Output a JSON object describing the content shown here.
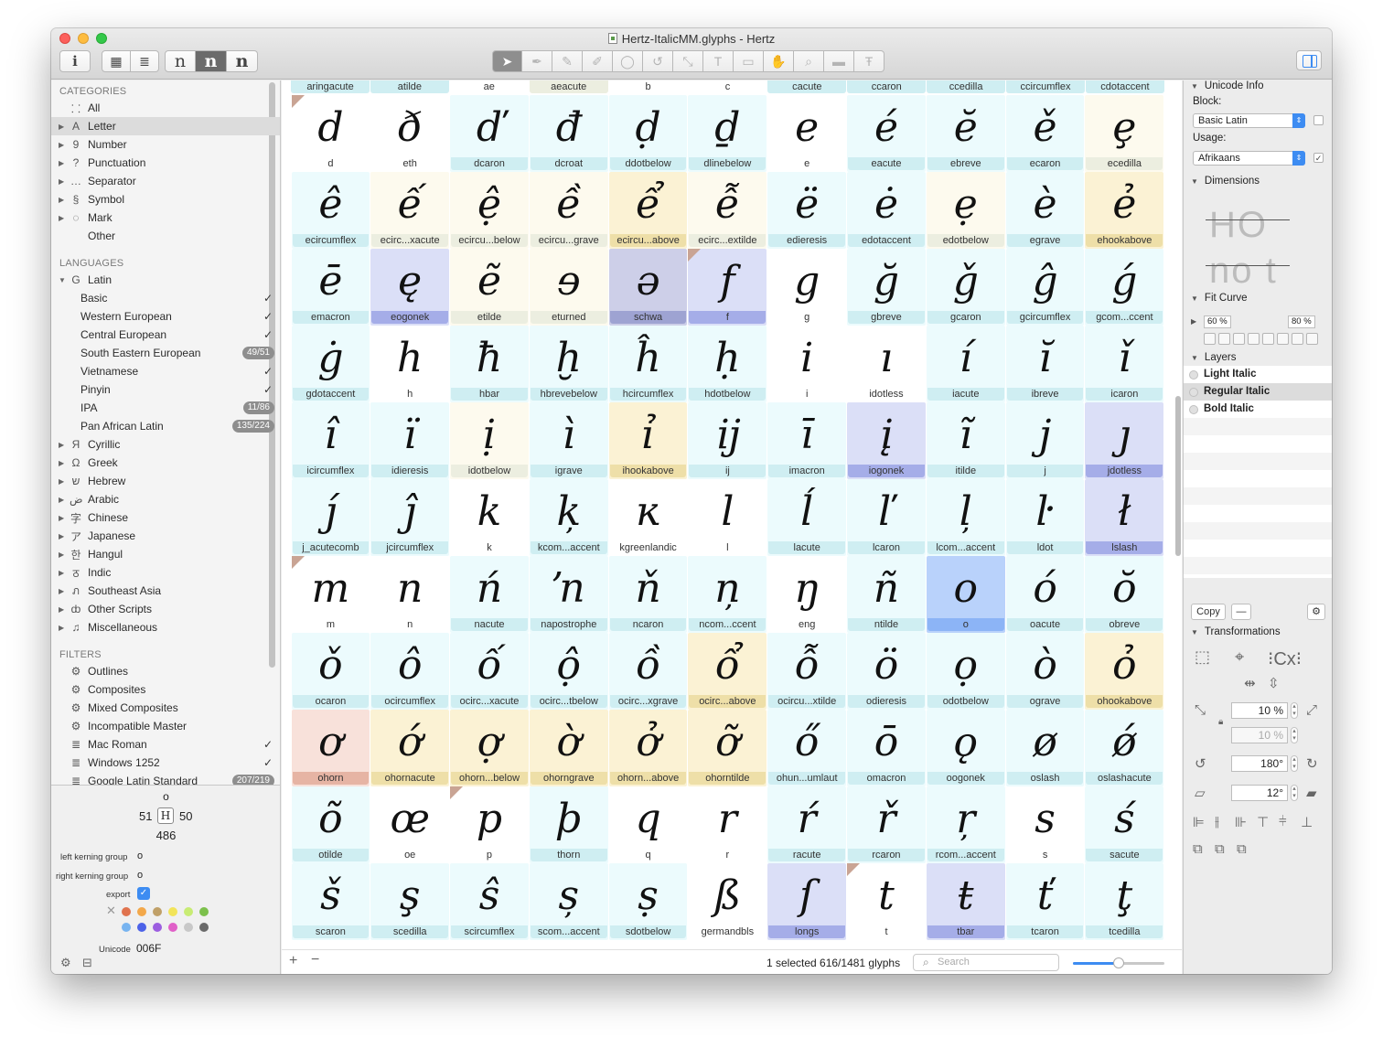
{
  "window": {
    "title": "Hertz-ItalicMM.glyphs - Hertz"
  },
  "toolbar": {
    "info_icon": "i",
    "grid_view_icon": "grid-icon",
    "list_view_icon": "list-icon",
    "preview_glyphs": [
      "n",
      "n",
      "n"
    ],
    "tools": [
      "select-tool",
      "draw-tool",
      "pencil-tool",
      "brush-tool",
      "primitives-tool",
      "rotate-tool",
      "scale-tool",
      "text-tool",
      "annotation-tool",
      "hand-tool",
      "zoom-tool",
      "measurement-tool",
      "type-tool"
    ]
  },
  "sidebar": {
    "categories_header": "CATEGORIES",
    "categories": [
      {
        "icon": "⸬",
        "label": "All"
      },
      {
        "icon": "A",
        "label": "Letter",
        "selected": true,
        "expandable": true
      },
      {
        "icon": "9",
        "label": "Number",
        "expandable": true
      },
      {
        "icon": "?",
        "label": "Punctuation",
        "expandable": true
      },
      {
        "icon": "…",
        "label": "Separator",
        "expandable": true
      },
      {
        "icon": "§",
        "label": "Symbol",
        "expandable": true
      },
      {
        "icon": "◌",
        "label": "Mark",
        "expandable": true
      },
      {
        "icon": "",
        "label": "Other"
      }
    ],
    "languages_header": "LANGUAGES",
    "latin": {
      "icon": "G",
      "label": "Latin"
    },
    "latin_items": [
      {
        "label": "Basic",
        "check": "✓"
      },
      {
        "label": "Western European",
        "check": "✓"
      },
      {
        "label": "Central European",
        "check": "✓"
      },
      {
        "label": "South Eastern European",
        "badge": "49/51"
      },
      {
        "label": "Vietnamese",
        "check": "✓"
      },
      {
        "label": "Pinyin",
        "check": "✓"
      },
      {
        "label": "IPA",
        "badge": "11/86"
      },
      {
        "label": "Pan African Latin",
        "badge": "135/224"
      }
    ],
    "scripts": [
      {
        "icon": "Я",
        "label": "Cyrillic"
      },
      {
        "icon": "Ω",
        "label": "Greek"
      },
      {
        "icon": "ש",
        "label": "Hebrew"
      },
      {
        "icon": "ض",
        "label": "Arabic"
      },
      {
        "icon": "字",
        "label": "Chinese"
      },
      {
        "icon": "ア",
        "label": "Japanese"
      },
      {
        "icon": "한",
        "label": "Hangul"
      },
      {
        "icon": "ठ",
        "label": "Indic"
      },
      {
        "icon": "ภ",
        "label": "Southeast Asia"
      },
      {
        "icon": "ȸ",
        "label": "Other Scripts"
      },
      {
        "icon": "♫",
        "label": "Miscellaneous"
      }
    ],
    "filters_header": "FILTERS",
    "filters": [
      {
        "icon": "⚙",
        "label": "Outlines"
      },
      {
        "icon": "⚙",
        "label": "Composites"
      },
      {
        "icon": "⚙",
        "label": "Mixed Composites"
      },
      {
        "icon": "⚙",
        "label": "Incompatible Master"
      },
      {
        "icon": "≣",
        "label": "Mac Roman",
        "check": "✓"
      },
      {
        "icon": "≣",
        "label": "Windows 1252",
        "check": "✓"
      },
      {
        "icon": "≣",
        "label": "Google Latin Standard",
        "badge": "207/219"
      }
    ]
  },
  "glyph_info": {
    "name": "o",
    "lsb": "51",
    "rsb": "50",
    "width": "486",
    "glyph_char": "H",
    "left_kerning_label": "left kerning group",
    "left_kerning_value": "o",
    "right_kerning_label": "right kerning group",
    "right_kerning_value": "o",
    "export_label": "export",
    "export_checked": "✓",
    "unicode_label": "Unicode",
    "unicode_value": "006F",
    "color_clear": "✕",
    "colors_row1": [
      "#e0734e",
      "#f3a84a",
      "#c0a068",
      "#f2e45a",
      "#c8ec74",
      "#7cc04c"
    ],
    "colors_row2": [
      "#78b4f0",
      "#4c62e8",
      "#9c5ee0",
      "#e060c8",
      "#c8c8c8",
      "#6a6a6a"
    ]
  },
  "grid": {
    "top_row": [
      {
        "name": "aringacute",
        "kind": "cyan"
      },
      {
        "name": "atilde",
        "kind": "cyan"
      },
      {
        "name": "ae",
        "kind": "white"
      },
      {
        "name": "aeacute",
        "kind": "cream"
      },
      {
        "name": "b",
        "kind": "white"
      },
      {
        "name": "c",
        "kind": "white"
      },
      {
        "name": "cacute",
        "kind": "cyan"
      },
      {
        "name": "ccaron",
        "kind": "cyan"
      },
      {
        "name": "ccedilla",
        "kind": "cyan"
      },
      {
        "name": "ccircumflex",
        "kind": "cyan"
      },
      {
        "name": "cdotaccent",
        "kind": "cyan"
      }
    ],
    "cells": [
      {
        "g": "d",
        "name": "d",
        "kind": "white",
        "corner": true
      },
      {
        "g": "ð",
        "name": "eth",
        "kind": "white"
      },
      {
        "g": "ď",
        "name": "dcaron",
        "kind": "cyan"
      },
      {
        "g": "đ",
        "name": "dcroat",
        "kind": "cyan"
      },
      {
        "g": "ḍ",
        "name": "ddotbelow",
        "kind": "cyan"
      },
      {
        "g": "ḏ",
        "name": "dlinebelow",
        "kind": "cyan"
      },
      {
        "g": "e",
        "name": "e",
        "kind": "white"
      },
      {
        "g": "é",
        "name": "eacute",
        "kind": "cyan"
      },
      {
        "g": "ĕ",
        "name": "ebreve",
        "kind": "cyan"
      },
      {
        "g": "ě",
        "name": "ecaron",
        "kind": "cyan"
      },
      {
        "g": "ȩ",
        "name": "ecedilla",
        "kind": "cream"
      },
      {
        "g": "ê",
        "name": "ecircumflex",
        "kind": "cyan"
      },
      {
        "g": "ế",
        "name": "ecirc...xacute",
        "kind": "cream"
      },
      {
        "g": "ệ",
        "name": "ecircu...below",
        "kind": "cream"
      },
      {
        "g": "ề",
        "name": "ecircu...grave",
        "kind": "cream"
      },
      {
        "g": "ể",
        "name": "ecircu...above",
        "kind": "yellow"
      },
      {
        "g": "ễ",
        "name": "ecirc...extilde",
        "kind": "cream"
      },
      {
        "g": "ë",
        "name": "edieresis",
        "kind": "cyan"
      },
      {
        "g": "ė",
        "name": "edotaccent",
        "kind": "cyan"
      },
      {
        "g": "ẹ",
        "name": "edotbelow",
        "kind": "cream"
      },
      {
        "g": "è",
        "name": "egrave",
        "kind": "cyan"
      },
      {
        "g": "ẻ",
        "name": "ehookabove",
        "kind": "yellow"
      },
      {
        "g": "ē",
        "name": "emacron",
        "kind": "cyan"
      },
      {
        "g": "ę",
        "name": "eogonek",
        "kind": "purple"
      },
      {
        "g": "ẽ",
        "name": "etilde",
        "kind": "cream"
      },
      {
        "g": "ɘ",
        "name": "eturned",
        "kind": "cream"
      },
      {
        "g": "ə",
        "name": "schwa",
        "kind": "schwa"
      },
      {
        "g": "f",
        "name": "f",
        "kind": "purple",
        "corner": true
      },
      {
        "g": "g",
        "name": "g",
        "kind": "white"
      },
      {
        "g": "ğ",
        "name": "gbreve",
        "kind": "cyan"
      },
      {
        "g": "ǧ",
        "name": "gcaron",
        "kind": "cyan"
      },
      {
        "g": "ĝ",
        "name": "gcircumflex",
        "kind": "cyan"
      },
      {
        "g": "ǵ",
        "name": "gcom...ccent",
        "kind": "cyan"
      },
      {
        "g": "ġ",
        "name": "gdotaccent",
        "kind": "cyan"
      },
      {
        "g": "h",
        "name": "h",
        "kind": "white"
      },
      {
        "g": "ħ",
        "name": "hbar",
        "kind": "cyan"
      },
      {
        "g": "ḫ",
        "name": "hbrevebelow",
        "kind": "cyan"
      },
      {
        "g": "ĥ",
        "name": "hcircumflex",
        "kind": "cyan"
      },
      {
        "g": "ḥ",
        "name": "hdotbelow",
        "kind": "cyan"
      },
      {
        "g": "i",
        "name": "i",
        "kind": "white"
      },
      {
        "g": "ı",
        "name": "idotless",
        "kind": "white"
      },
      {
        "g": "í",
        "name": "iacute",
        "kind": "cyan"
      },
      {
        "g": "ĭ",
        "name": "ibreve",
        "kind": "cyan"
      },
      {
        "g": "ǐ",
        "name": "icaron",
        "kind": "cyan"
      },
      {
        "g": "î",
        "name": "icircumflex",
        "kind": "cyan"
      },
      {
        "g": "ï",
        "name": "idieresis",
        "kind": "cyan"
      },
      {
        "g": "ị",
        "name": "idotbelow",
        "kind": "cream"
      },
      {
        "g": "ì",
        "name": "igrave",
        "kind": "cyan"
      },
      {
        "g": "ỉ",
        "name": "ihookabove",
        "kind": "yellow"
      },
      {
        "g": "ĳ",
        "name": "ij",
        "kind": "cyan"
      },
      {
        "g": "ī",
        "name": "imacron",
        "kind": "cyan"
      },
      {
        "g": "į",
        "name": "iogonek",
        "kind": "purple"
      },
      {
        "g": "ĩ",
        "name": "itilde",
        "kind": "cyan"
      },
      {
        "g": "j",
        "name": "j",
        "kind": "cyan"
      },
      {
        "g": "ȷ",
        "name": "jdotless",
        "kind": "purple"
      },
      {
        "g": "ȷ́",
        "name": "j_acutecomb",
        "kind": "cyan"
      },
      {
        "g": "ĵ",
        "name": "jcircumflex",
        "kind": "cyan"
      },
      {
        "g": "k",
        "name": "k",
        "kind": "white"
      },
      {
        "g": "ķ",
        "name": "kcom...accent",
        "kind": "cyan"
      },
      {
        "g": "ĸ",
        "name": "kgreenlandic",
        "kind": "white"
      },
      {
        "g": "l",
        "name": "l",
        "kind": "white"
      },
      {
        "g": "ĺ",
        "name": "lacute",
        "kind": "cyan"
      },
      {
        "g": "ľ",
        "name": "lcaron",
        "kind": "cyan"
      },
      {
        "g": "ļ",
        "name": "lcom...accent",
        "kind": "cyan"
      },
      {
        "g": "ŀ",
        "name": "ldot",
        "kind": "cyan"
      },
      {
        "g": "ł",
        "name": "lslash",
        "kind": "purple"
      },
      {
        "g": "m",
        "name": "m",
        "kind": "white",
        "corner": true
      },
      {
        "g": "n",
        "name": "n",
        "kind": "white"
      },
      {
        "g": "ń",
        "name": "nacute",
        "kind": "cyan"
      },
      {
        "g": "ŉ",
        "name": "napostrophe",
        "kind": "cyan"
      },
      {
        "g": "ň",
        "name": "ncaron",
        "kind": "cyan"
      },
      {
        "g": "ņ",
        "name": "ncom...ccent",
        "kind": "cyan"
      },
      {
        "g": "ŋ",
        "name": "eng",
        "kind": "white"
      },
      {
        "g": "ñ",
        "name": "ntilde",
        "kind": "cyan"
      },
      {
        "g": "o",
        "name": "o",
        "kind": "sel"
      },
      {
        "g": "ó",
        "name": "oacute",
        "kind": "cyan"
      },
      {
        "g": "ŏ",
        "name": "obreve",
        "kind": "cyan"
      },
      {
        "g": "ǒ",
        "name": "ocaron",
        "kind": "cyan"
      },
      {
        "g": "ô",
        "name": "ocircumflex",
        "kind": "cyan"
      },
      {
        "g": "ố",
        "name": "ocirc...xacute",
        "kind": "cyan"
      },
      {
        "g": "ộ",
        "name": "ocirc...tbelow",
        "kind": "cyan"
      },
      {
        "g": "ồ",
        "name": "ocirc...xgrave",
        "kind": "cyan"
      },
      {
        "g": "ổ",
        "name": "ocirc...above",
        "kind": "yellow"
      },
      {
        "g": "ỗ",
        "name": "ocircu...xtilde",
        "kind": "cyan"
      },
      {
        "g": "ö",
        "name": "odieresis",
        "kind": "cyan"
      },
      {
        "g": "ọ",
        "name": "odotbelow",
        "kind": "cyan"
      },
      {
        "g": "ò",
        "name": "ograve",
        "kind": "cyan"
      },
      {
        "g": "ỏ",
        "name": "ohookabove",
        "kind": "yellow"
      },
      {
        "g": "ơ",
        "name": "ohorn",
        "kind": "pink"
      },
      {
        "g": "ớ",
        "name": "ohornacute",
        "kind": "yellow"
      },
      {
        "g": "ợ",
        "name": "ohorn...below",
        "kind": "yellow"
      },
      {
        "g": "ờ",
        "name": "ohorngrave",
        "kind": "yellow"
      },
      {
        "g": "ở",
        "name": "ohorn...above",
        "kind": "yellow"
      },
      {
        "g": "ỡ",
        "name": "ohorntilde",
        "kind": "yellow"
      },
      {
        "g": "ő",
        "name": "ohun...umlaut",
        "kind": "cyan"
      },
      {
        "g": "ō",
        "name": "omacron",
        "kind": "cyan"
      },
      {
        "g": "ǫ",
        "name": "oogonek",
        "kind": "cyan"
      },
      {
        "g": "ø",
        "name": "oslash",
        "kind": "cyan"
      },
      {
        "g": "ǿ",
        "name": "oslashacute",
        "kind": "cyan"
      },
      {
        "g": "õ",
        "name": "otilde",
        "kind": "cyan"
      },
      {
        "g": "œ",
        "name": "oe",
        "kind": "white"
      },
      {
        "g": "p",
        "name": "p",
        "kind": "white",
        "corner": true
      },
      {
        "g": "þ",
        "name": "thorn",
        "kind": "cyan"
      },
      {
        "g": "q",
        "name": "q",
        "kind": "white"
      },
      {
        "g": "r",
        "name": "r",
        "kind": "white"
      },
      {
        "g": "ŕ",
        "name": "racute",
        "kind": "cyan"
      },
      {
        "g": "ř",
        "name": "rcaron",
        "kind": "cyan"
      },
      {
        "g": "ŗ",
        "name": "rcom...accent",
        "kind": "cyan"
      },
      {
        "g": "s",
        "name": "s",
        "kind": "white"
      },
      {
        "g": "ś",
        "name": "sacute",
        "kind": "cyan"
      },
      {
        "g": "š",
        "name": "scaron",
        "kind": "cyan"
      },
      {
        "g": "ş",
        "name": "scedilla",
        "kind": "cyan"
      },
      {
        "g": "ŝ",
        "name": "scircumflex",
        "kind": "cyan"
      },
      {
        "g": "ș",
        "name": "scom...accent",
        "kind": "cyan"
      },
      {
        "g": "ṣ",
        "name": "sdotbelow",
        "kind": "cyan"
      },
      {
        "g": "ß",
        "name": "germandbls",
        "kind": "white"
      },
      {
        "g": "ſ",
        "name": "longs",
        "kind": "purple"
      },
      {
        "g": "t",
        "name": "t",
        "kind": "white",
        "corner": true
      },
      {
        "g": "ŧ",
        "name": "tbar",
        "kind": "purple"
      },
      {
        "g": "ť",
        "name": "tcaron",
        "kind": "cyan"
      },
      {
        "g": "ţ",
        "name": "tcedilla",
        "kind": "cyan"
      }
    ]
  },
  "statusbar": {
    "add": "+",
    "remove": "−",
    "status": "1 selected 616/1481 glyphs",
    "search_placeholder": "Search",
    "zoom_level": 0.5
  },
  "inspector": {
    "unicode_info": "Unicode Info",
    "block_label": "Block:",
    "block_value": "Basic Latin",
    "usage_label": "Usage:",
    "usage_value": "Afrikaans",
    "usage_checked": "✓",
    "dimensions": "Dimensions",
    "dim_preview_top": "HO",
    "dim_preview_bottom": "no t",
    "fit_curve": "Fit Curve",
    "fit_min": "60 %",
    "fit_max": "80 %",
    "layers": "Layers",
    "layer_list": [
      {
        "name": "Light Italic"
      },
      {
        "name": "Regular Italic",
        "selected": true
      },
      {
        "name": "Bold Italic"
      }
    ],
    "copy_button": "Copy",
    "dash_button": "—",
    "transformations": "Transformations",
    "scale_x": "10 %",
    "scale_y": "10 %",
    "rotate": "180°",
    "slant": "12°"
  }
}
